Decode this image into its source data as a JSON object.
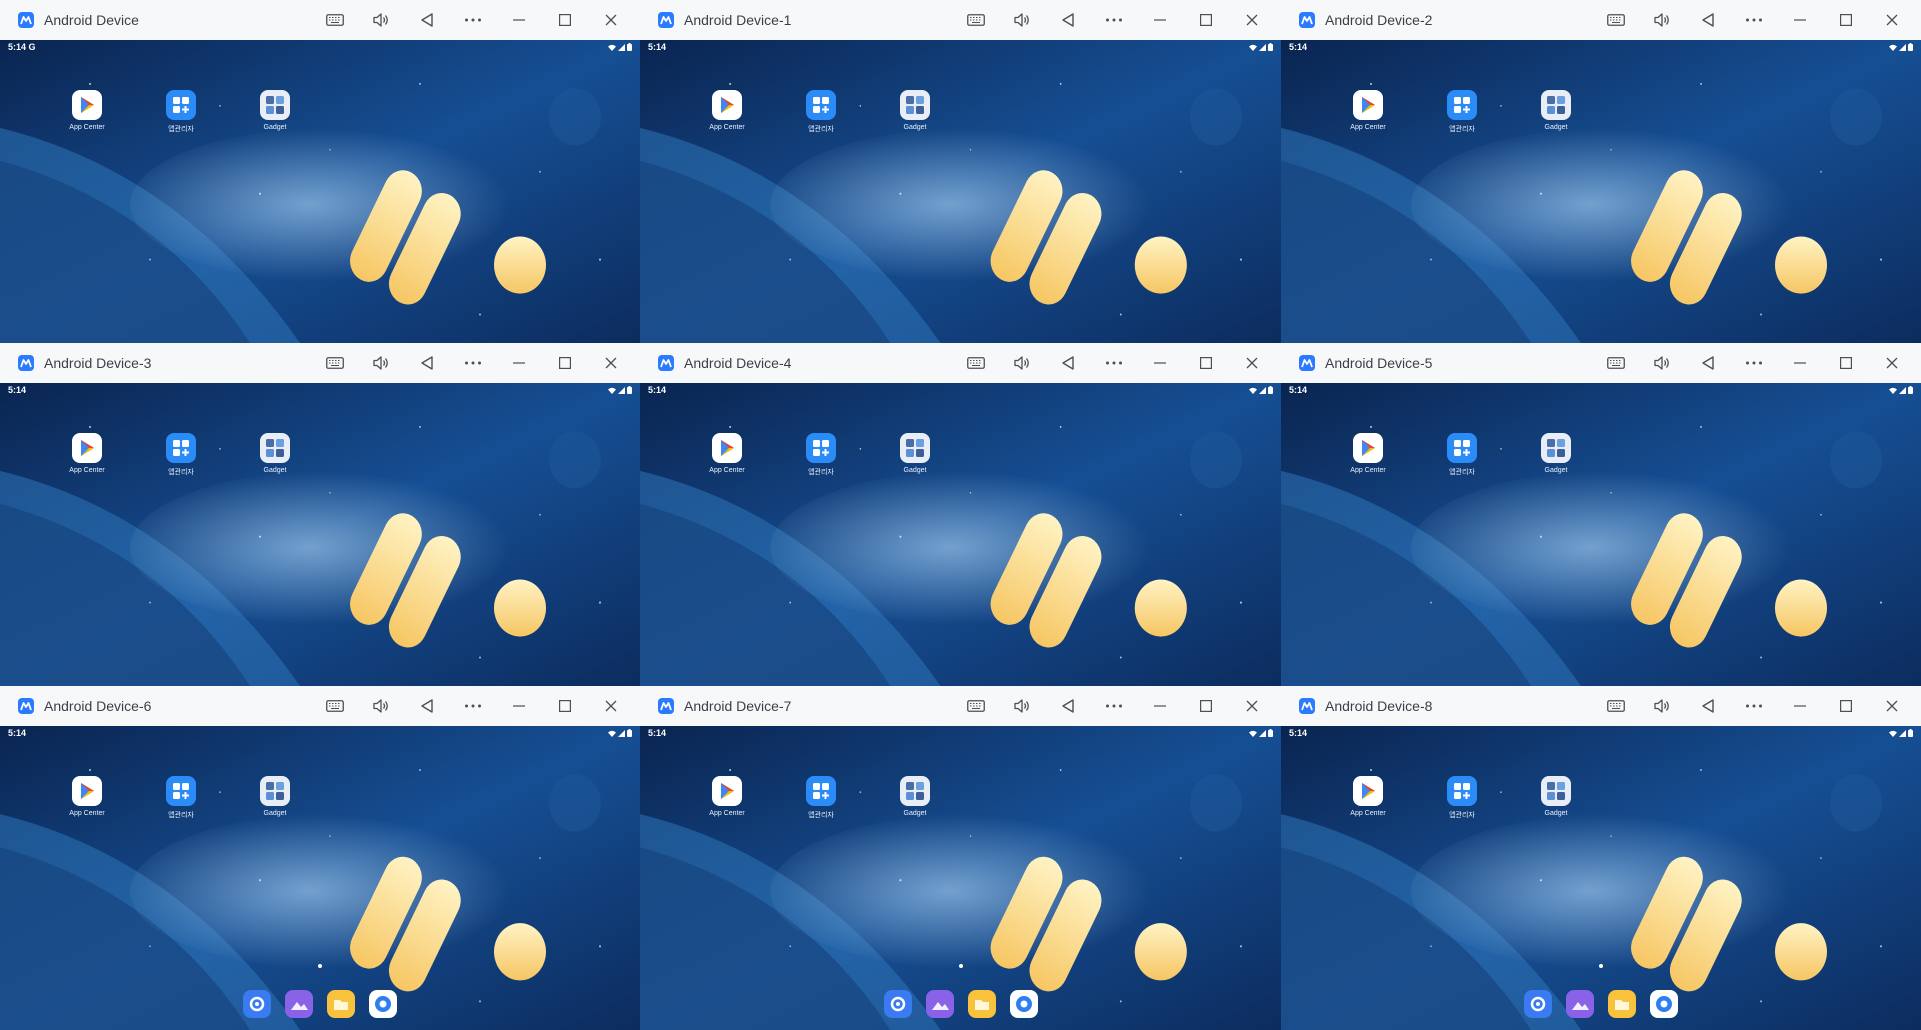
{
  "windows": [
    {
      "title": "Android Device",
      "time": "5:14",
      "status_extra": "G",
      "dock": false
    },
    {
      "title": "Android Device-1",
      "time": "5:14",
      "status_extra": "",
      "dock": false
    },
    {
      "title": "Android Device-2",
      "time": "5:14",
      "status_extra": "",
      "dock": false
    },
    {
      "title": "Android Device-3",
      "time": "5:14",
      "status_extra": "",
      "dock": false
    },
    {
      "title": "Android Device-4",
      "time": "5:14",
      "status_extra": "",
      "dock": false
    },
    {
      "title": "Android Device-5",
      "time": "5:14",
      "status_extra": "",
      "dock": false
    },
    {
      "title": "Android Device-6",
      "time": "5:14",
      "status_extra": "",
      "dock": true
    },
    {
      "title": "Android Device-7",
      "time": "5:14",
      "status_extra": "",
      "dock": true
    },
    {
      "title": "Android Device-8",
      "time": "5:14",
      "status_extra": "",
      "dock": true
    }
  ],
  "toolbar_icons": [
    "keyboard-icon",
    "volume-icon",
    "back-icon",
    "more-icon",
    "minimize-icon",
    "maximize-icon",
    "close-icon"
  ],
  "home_apps": [
    {
      "label": "App Center",
      "icon": "app-center-icon"
    },
    {
      "label": "앱관리자",
      "icon": "app-manager-icon"
    },
    {
      "label": "Gadget",
      "icon": "gadget-icon"
    }
  ],
  "dock_apps": [
    "settings-icon",
    "gallery-icon",
    "files-icon",
    "browser-icon"
  ],
  "colors": {
    "accent": "#2a7bff",
    "wallpaper_top": "#0c2f63",
    "wallpaper_bottom": "#0f3c78",
    "capsule": "#f9d47b"
  }
}
